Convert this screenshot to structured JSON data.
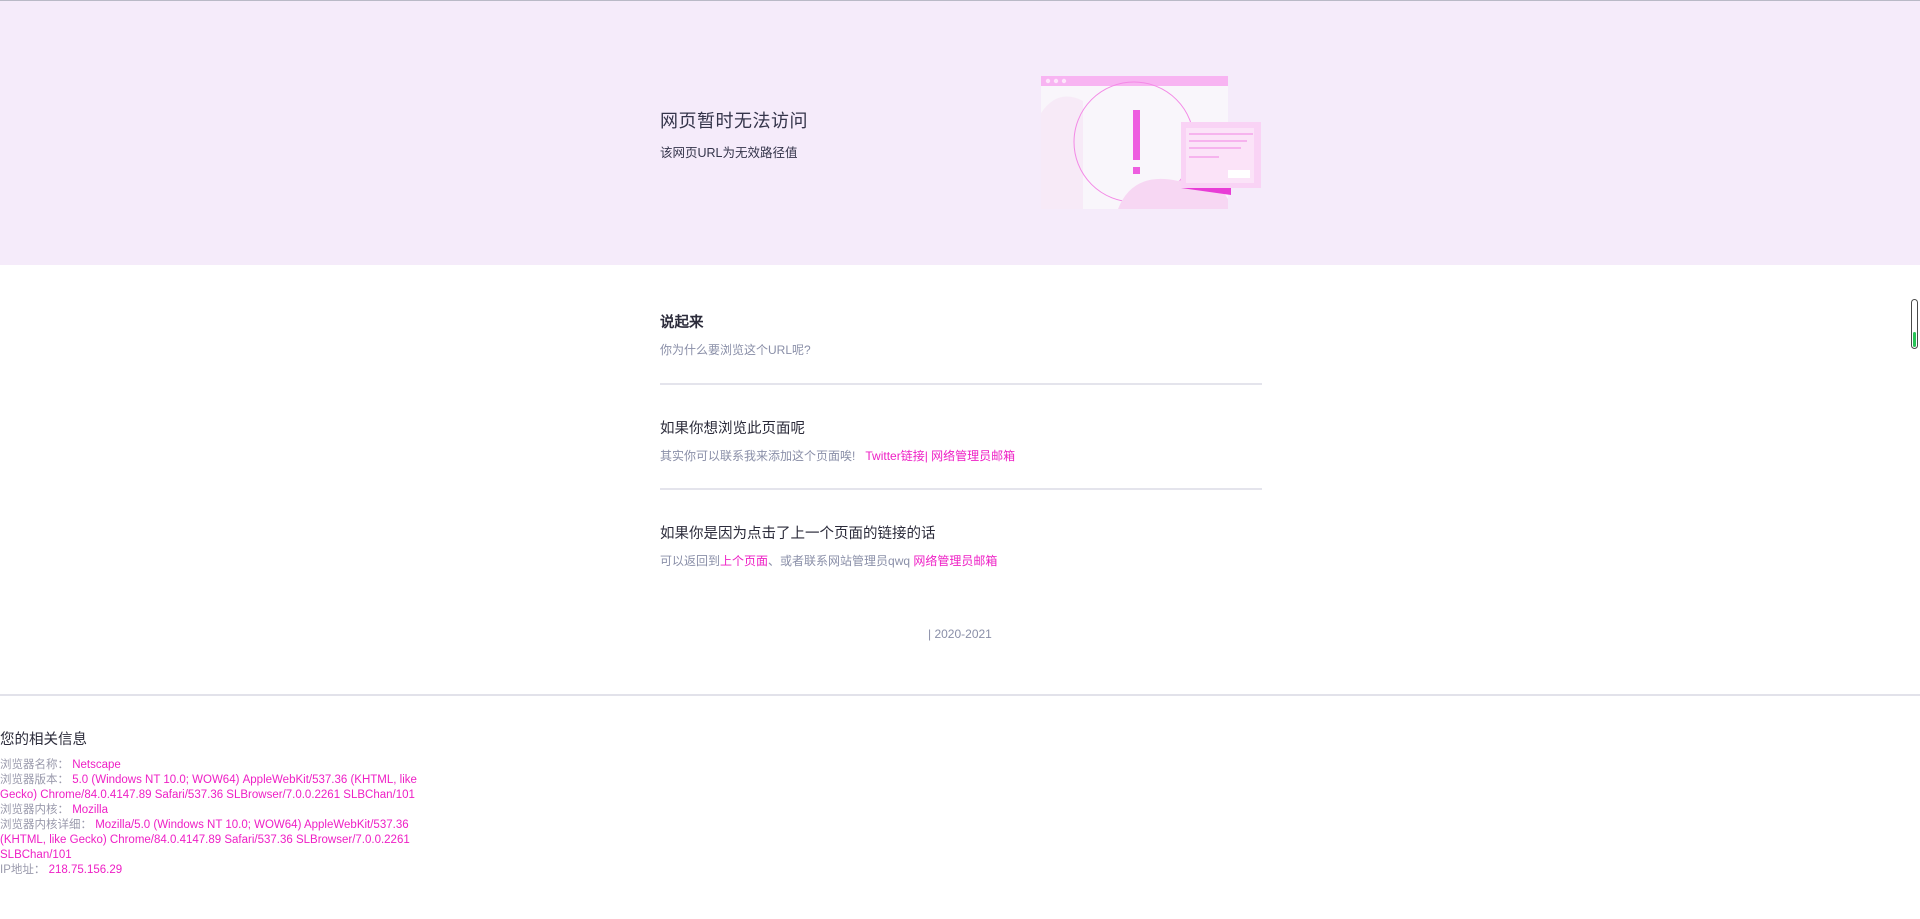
{
  "hero": {
    "title": "网页暂时无法访问",
    "subtitle": "该网页URL为无效路径值"
  },
  "sections": [
    {
      "title": "说起来",
      "desc": "你为什么要浏览这个URL呢?"
    },
    {
      "title": "如果你想浏览此页面呢",
      "desc_prefix": "其实你可以联系我来添加这个页面唉!",
      "link1": "Twitter链接",
      "separator": "|",
      "link2": "网络管理员邮箱"
    },
    {
      "title": "如果你是因为点击了上一个页面的链接的话",
      "desc_prefix": "可以返回到",
      "link1": "上个页面",
      "desc_mid": "、或者联系网站管理员qwq",
      "link2": "网络管理员邮箱"
    }
  ],
  "copyright": "| 2020-2021",
  "info": {
    "title": "您的相关信息",
    "rows": [
      {
        "label": "浏览器名称：",
        "value": "Netscape"
      },
      {
        "label": "浏览器版本：",
        "value": "5.0 (Windows NT 10.0; WOW64) AppleWebKit/537.36 (KHTML, like Gecko) Chrome/84.0.4147.89 Safari/537.36 SLBrowser/7.0.0.2261 SLBChan/101"
      },
      {
        "label": "浏览器内核：",
        "value": "Mozilla"
      },
      {
        "label": "浏览器内核详细：",
        "value": "Mozilla/5.0 (Windows NT 10.0; WOW64) AppleWebKit/537.36 (KHTML, like Gecko) Chrome/84.0.4147.89 Safari/537.36 SLBrowser/7.0.0.2261 SLBChan/101"
      },
      {
        "label": "IP地址：",
        "value": "218.75.156.29"
      }
    ]
  },
  "colors": {
    "accent": "#ee1fc5",
    "hero_bg": "#f5ebfa",
    "muted_text": "#8a8fa8"
  },
  "icons": {
    "hero_illustration": "error-page-illustration",
    "scroll_widget": "scroll-progress-indicator"
  },
  "scroll_widget": {
    "fill_fraction": 0.33
  }
}
